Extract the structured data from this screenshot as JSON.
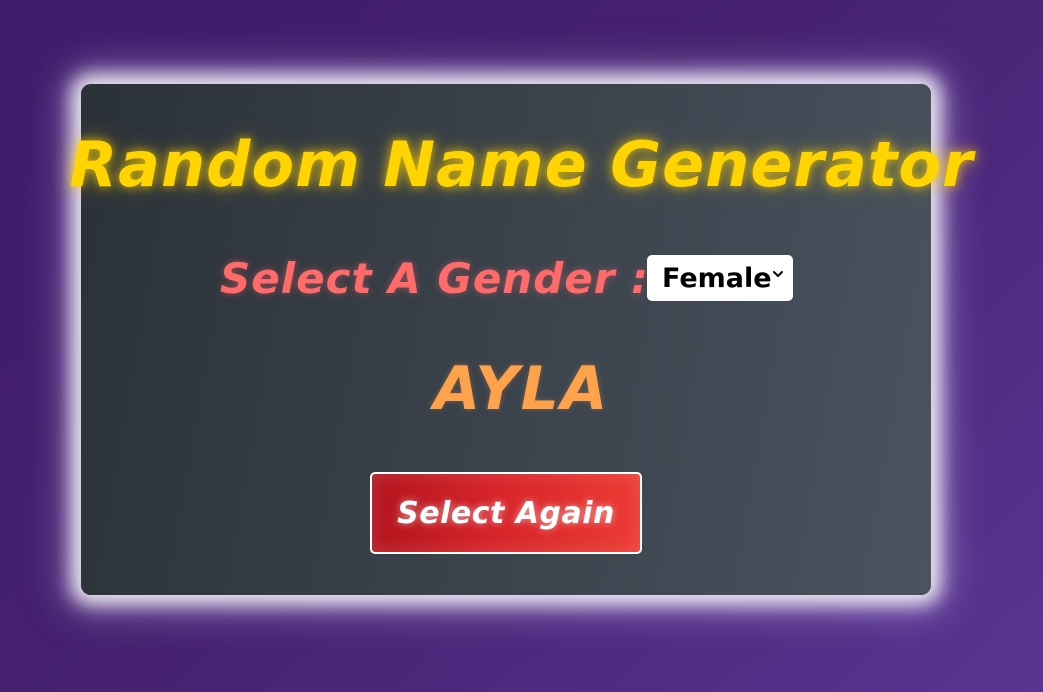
{
  "app": {
    "title": "Random Name Generator"
  },
  "gender": {
    "label": "Select A Gender :",
    "selected": "Female",
    "icon": "chevron-down-icon"
  },
  "result": {
    "name": "AYLA"
  },
  "actions": {
    "select_again_label": "Select Again"
  },
  "colors": {
    "background": "#45216f",
    "card": "#3a424b",
    "title": "#ffd400",
    "label": "#ff6b6b",
    "name": "#ffa24c",
    "button": "#d6242a"
  }
}
